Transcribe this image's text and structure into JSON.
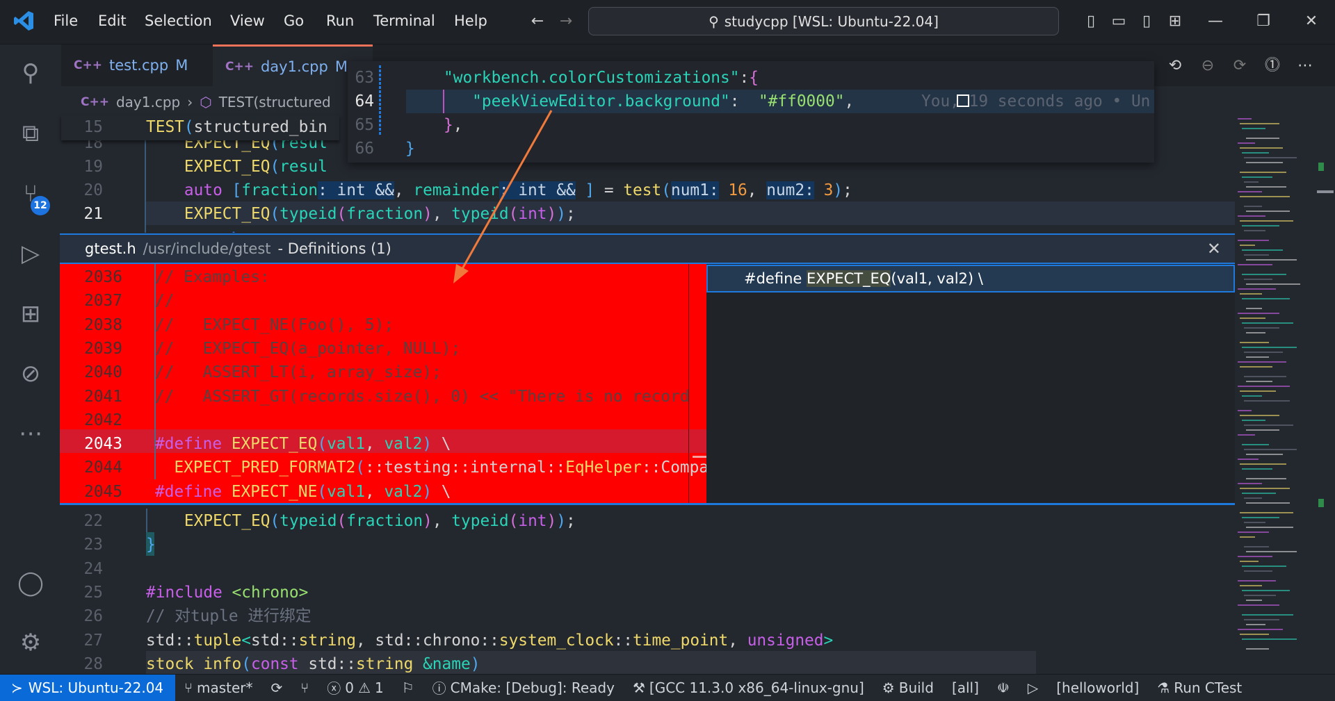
{
  "titlebar": {
    "menu": [
      "File",
      "Edit",
      "Selection",
      "View",
      "Go",
      "Run",
      "Terminal",
      "Help"
    ],
    "search": "studycpp [WSL: Ubuntu-22.04]"
  },
  "activity": {
    "scm_badge": "12"
  },
  "tabs": [
    {
      "label": "test.cpp",
      "status": "M"
    },
    {
      "label": "day1.cpp",
      "status": "M"
    }
  ],
  "breadcrumb": {
    "file": "day1.cpp",
    "symbol": "TEST(structured"
  },
  "editor_top": {
    "sticky": {
      "n": "15",
      "tokens": [
        [
          "TEST",
          "fn"
        ],
        [
          "(",
          "b1"
        ],
        [
          "structured_bin",
          "pl"
        ]
      ]
    },
    "lines": [
      {
        "n": "18",
        "tokens": [
          [
            "    ",
            "pl"
          ],
          [
            "EXPECT_EQ",
            "fn"
          ],
          [
            "(",
            "b1"
          ],
          [
            "resul",
            "var"
          ]
        ]
      },
      {
        "n": "19",
        "tokens": [
          [
            "    ",
            "pl"
          ],
          [
            "EXPECT_EQ",
            "fn"
          ],
          [
            "(",
            "b1"
          ],
          [
            "resul",
            "var"
          ]
        ]
      },
      {
        "n": "20",
        "tokens": [
          [
            "    ",
            "pl"
          ],
          [
            "auto ",
            "kw"
          ],
          [
            "[",
            "b1"
          ],
          [
            "fraction",
            "var"
          ],
          [
            ": int &&",
            "hint"
          ],
          [
            ", ",
            "pl"
          ],
          [
            "remainder",
            "var"
          ],
          [
            ": int &&",
            "hint"
          ],
          [
            " ]",
            "b1"
          ],
          [
            " = ",
            "pl"
          ],
          [
            "test",
            "fn"
          ],
          [
            "(",
            "b1"
          ],
          [
            "num1:",
            "hint"
          ],
          [
            " ",
            "pl"
          ],
          [
            "16",
            "num"
          ],
          [
            ", ",
            "pl"
          ],
          [
            "num2:",
            "hint"
          ],
          [
            " ",
            "pl"
          ],
          [
            "3",
            "num"
          ],
          [
            ")",
            "b1"
          ],
          [
            ";",
            "pl"
          ]
        ]
      },
      {
        "n": "21",
        "tokens": [
          [
            "    ",
            "pl"
          ],
          [
            "EXPECT_EQ",
            "fn"
          ],
          [
            "(",
            "b1"
          ],
          [
            "typeid",
            "var"
          ],
          [
            "(",
            "b2"
          ],
          [
            "fraction",
            "var"
          ],
          [
            ")",
            "b2"
          ],
          [
            ", ",
            "pl"
          ],
          [
            "typeid",
            "var"
          ],
          [
            "(",
            "b2"
          ],
          [
            "int",
            "kw"
          ],
          [
            ")",
            "b2"
          ],
          [
            ")",
            "b1"
          ],
          [
            ";",
            "pl"
          ]
        ]
      }
    ]
  },
  "hover": {
    "lines": [
      {
        "n": "63",
        "tokens": [
          [
            "\"workbench.colorCustomizations\"",
            "var"
          ],
          [
            ":",
            "pl"
          ],
          [
            "{",
            "b2"
          ]
        ]
      },
      {
        "n": "64",
        "tokens": [
          [
            "   \"peekViewEditor.background\"",
            "var"
          ],
          [
            ":",
            "pl"
          ],
          [
            "  ",
            "pl"
          ],
          [
            "\"#ff0000\"",
            "str"
          ],
          [
            ",",
            "pl"
          ]
        ]
      },
      {
        "n": "65",
        "tokens": [
          [
            "}",
            "b2"
          ],
          [
            ",",
            "pl"
          ]
        ]
      },
      {
        "n": "66",
        "tokens": [
          [
            "}",
            "b1"
          ]
        ]
      }
    ],
    "blame": "You, 19 seconds ago • Un",
    "swatch": "#ff0000"
  },
  "peek": {
    "file": "gtest.h",
    "path": "/usr/include/gtest",
    "title": "- Definitions (1)",
    "background": "#ff0000",
    "lines": [
      {
        "n": "2036",
        "tokens": [
          [
            "// Examples:",
            "pcmt"
          ]
        ]
      },
      {
        "n": "2037",
        "tokens": [
          [
            "//",
            "pcmt"
          ]
        ]
      },
      {
        "n": "2038",
        "tokens": [
          [
            "//   EXPECT_NE(Foo(), 5);",
            "pcmt"
          ]
        ]
      },
      {
        "n": "2039",
        "tokens": [
          [
            "//   EXPECT_EQ(a_pointer, NULL);",
            "pcmt"
          ]
        ]
      },
      {
        "n": "2040",
        "tokens": [
          [
            "//   ASSERT_LT(i, array_size);",
            "pcmt"
          ]
        ]
      },
      {
        "n": "2041",
        "tokens": [
          [
            "//   ASSERT_GT(records.size(), 0) << \"There is no record",
            "pcmt"
          ]
        ]
      },
      {
        "n": "2042",
        "tokens": []
      },
      {
        "n": "2043",
        "tokens": [
          [
            "#define ",
            "kw"
          ],
          [
            "EXPECT_EQ",
            "fn"
          ],
          [
            "(",
            "b1"
          ],
          [
            "val1",
            "var"
          ],
          [
            ", ",
            "pl"
          ],
          [
            "val2",
            "var"
          ],
          [
            ")",
            "b1"
          ],
          [
            " \\",
            "pl"
          ]
        ]
      },
      {
        "n": "2044",
        "tokens": [
          [
            "  EXPECT_PRED_FORMAT2",
            "fn"
          ],
          [
            "(",
            "b1"
          ],
          [
            "::testing::internal::",
            "pl"
          ],
          [
            "EqHelper",
            "fn"
          ],
          [
            "::Compare",
            "pl"
          ]
        ]
      },
      {
        "n": "2045",
        "tokens": [
          [
            "#define ",
            "kw"
          ],
          [
            "EXPECT_NE",
            "fn"
          ],
          [
            "(",
            "b1"
          ],
          [
            "val1",
            "var"
          ],
          [
            ", ",
            "pl"
          ],
          [
            "val2",
            "var"
          ],
          [
            ")",
            "b1"
          ],
          [
            " \\",
            "pl"
          ]
        ]
      }
    ],
    "reference": {
      "prefix": "#define ",
      "match": "EXPECT_EQ",
      "suffix": "(val1, val2) \\"
    }
  },
  "editor_bottom": {
    "lines": [
      {
        "n": "22",
        "tokens": [
          [
            "    ",
            "pl"
          ],
          [
            "EXPECT_EQ",
            "fn"
          ],
          [
            "(",
            "b1"
          ],
          [
            "typeid",
            "var"
          ],
          [
            "(",
            "b2"
          ],
          [
            "fraction",
            "var"
          ],
          [
            ")",
            "b2"
          ],
          [
            ", ",
            "pl"
          ],
          [
            "typeid",
            "var"
          ],
          [
            "(",
            "b2"
          ],
          [
            "int",
            "kw"
          ],
          [
            ")",
            "b2"
          ],
          [
            ")",
            "b1"
          ],
          [
            ";",
            "pl"
          ]
        ]
      },
      {
        "n": "23",
        "tokens": [
          [
            "}",
            "b1"
          ]
        ]
      },
      {
        "n": "24",
        "tokens": []
      },
      {
        "n": "25",
        "tokens": [
          [
            "#include ",
            "kw"
          ],
          [
            "<chrono>",
            "inc"
          ]
        ]
      },
      {
        "n": "26",
        "tokens": [
          [
            "// 对tuple 进行绑定",
            "cmt"
          ]
        ]
      },
      {
        "n": "27",
        "tokens": [
          [
            "std::",
            "pl"
          ],
          [
            "tuple",
            "fn"
          ],
          [
            "<",
            "var"
          ],
          [
            "std::",
            "pl"
          ],
          [
            "string",
            "fn"
          ],
          [
            ", std::chrono::",
            "pl"
          ],
          [
            "system_clock",
            "fn"
          ],
          [
            "::",
            "pl"
          ],
          [
            "time_point",
            "fn"
          ],
          [
            ", ",
            "pl"
          ],
          [
            "unsigned",
            "kw"
          ],
          [
            ">",
            "var"
          ]
        ]
      },
      {
        "n": "28",
        "tokens": [
          [
            "stock ",
            "fn"
          ],
          [
            "info",
            "fn"
          ],
          [
            "(",
            "b1"
          ],
          [
            "const ",
            "kw"
          ],
          [
            "std::",
            "pl"
          ],
          [
            "string ",
            "fn"
          ],
          [
            "&name",
            "var"
          ],
          [
            ")",
            "b1"
          ]
        ]
      }
    ]
  },
  "status": {
    "remote": "WSL: Ubuntu-22.04",
    "branch": "master*",
    "errors": "0",
    "warnings": "1",
    "cmake": "CMake: [Debug]: Ready",
    "kit": "[GCC 11.3.0 x86_64-linux-gnu]",
    "build": "Build",
    "target": "[all]",
    "launch": "[helloworld]",
    "ctest": "Run CTest"
  }
}
